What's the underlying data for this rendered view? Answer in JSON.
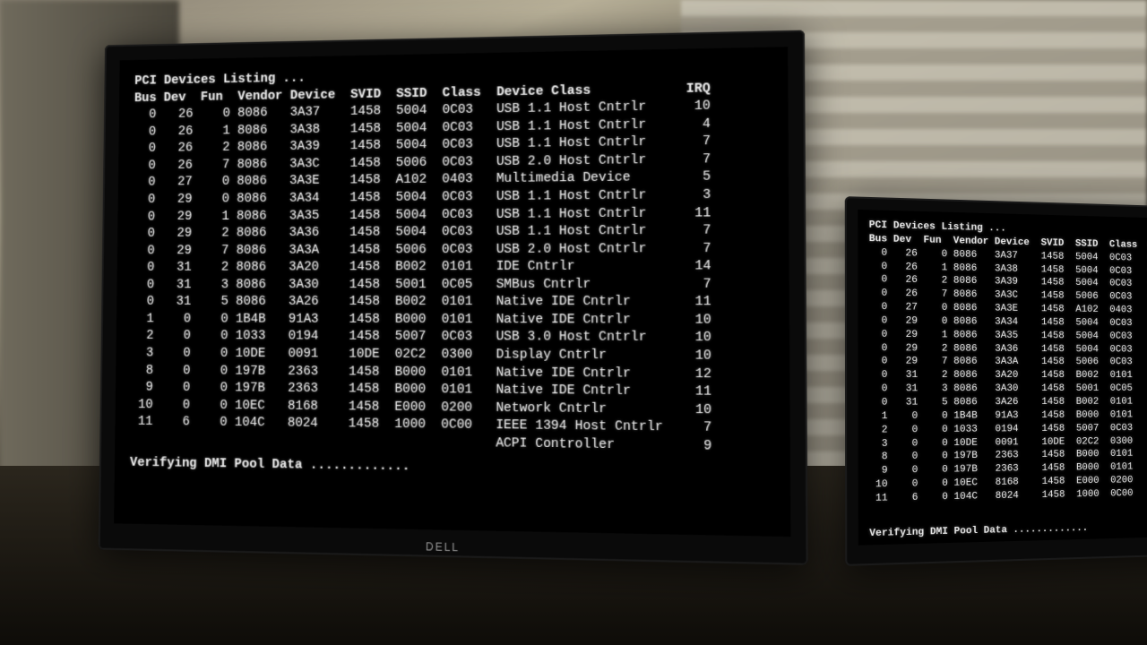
{
  "title": "PCI Devices Listing ...",
  "headers": {
    "bus": "Bus",
    "dev": "Dev",
    "fun": "Fun",
    "vendor": "Vendor",
    "device": "Device",
    "svid": "SVID",
    "ssid": "SSID",
    "class": "Class",
    "device_class": "Device Class",
    "irq": "IRQ"
  },
  "rows": [
    {
      "bus": "0",
      "dev": "26",
      "fun": "0",
      "vendor": "8086",
      "device": "3A37",
      "svid": "1458",
      "ssid": "5004",
      "class": "0C03",
      "device_class": "USB 1.1 Host Cntrlr",
      "irq": "10"
    },
    {
      "bus": "0",
      "dev": "26",
      "fun": "1",
      "vendor": "8086",
      "device": "3A38",
      "svid": "1458",
      "ssid": "5004",
      "class": "0C03",
      "device_class": "USB 1.1 Host Cntrlr",
      "irq": "4"
    },
    {
      "bus": "0",
      "dev": "26",
      "fun": "2",
      "vendor": "8086",
      "device": "3A39",
      "svid": "1458",
      "ssid": "5004",
      "class": "0C03",
      "device_class": "USB 1.1 Host Cntrlr",
      "irq": "7"
    },
    {
      "bus": "0",
      "dev": "26",
      "fun": "7",
      "vendor": "8086",
      "device": "3A3C",
      "svid": "1458",
      "ssid": "5006",
      "class": "0C03",
      "device_class": "USB 2.0 Host Cntrlr",
      "irq": "7"
    },
    {
      "bus": "0",
      "dev": "27",
      "fun": "0",
      "vendor": "8086",
      "device": "3A3E",
      "svid": "1458",
      "ssid": "A102",
      "class": "0403",
      "device_class": "Multimedia Device",
      "irq": "5"
    },
    {
      "bus": "0",
      "dev": "29",
      "fun": "0",
      "vendor": "8086",
      "device": "3A34",
      "svid": "1458",
      "ssid": "5004",
      "class": "0C03",
      "device_class": "USB 1.1 Host Cntrlr",
      "irq": "3"
    },
    {
      "bus": "0",
      "dev": "29",
      "fun": "1",
      "vendor": "8086",
      "device": "3A35",
      "svid": "1458",
      "ssid": "5004",
      "class": "0C03",
      "device_class": "USB 1.1 Host Cntrlr",
      "irq": "11"
    },
    {
      "bus": "0",
      "dev": "29",
      "fun": "2",
      "vendor": "8086",
      "device": "3A36",
      "svid": "1458",
      "ssid": "5004",
      "class": "0C03",
      "device_class": "USB 1.1 Host Cntrlr",
      "irq": "7"
    },
    {
      "bus": "0",
      "dev": "29",
      "fun": "7",
      "vendor": "8086",
      "device": "3A3A",
      "svid": "1458",
      "ssid": "5006",
      "class": "0C03",
      "device_class": "USB 2.0 Host Cntrlr",
      "irq": "7"
    },
    {
      "bus": "0",
      "dev": "31",
      "fun": "2",
      "vendor": "8086",
      "device": "3A20",
      "svid": "1458",
      "ssid": "B002",
      "class": "0101",
      "device_class": "IDE Cntrlr",
      "irq": "14"
    },
    {
      "bus": "0",
      "dev": "31",
      "fun": "3",
      "vendor": "8086",
      "device": "3A30",
      "svid": "1458",
      "ssid": "5001",
      "class": "0C05",
      "device_class": "SMBus Cntrlr",
      "irq": "7"
    },
    {
      "bus": "0",
      "dev": "31",
      "fun": "5",
      "vendor": "8086",
      "device": "3A26",
      "svid": "1458",
      "ssid": "B002",
      "class": "0101",
      "device_class": "Native IDE Cntrlr",
      "irq": "11"
    },
    {
      "bus": "1",
      "dev": "0",
      "fun": "0",
      "vendor": "1B4B",
      "device": "91A3",
      "svid": "1458",
      "ssid": "B000",
      "class": "0101",
      "device_class": "Native IDE Cntrlr",
      "irq": "10"
    },
    {
      "bus": "2",
      "dev": "0",
      "fun": "0",
      "vendor": "1033",
      "device": "0194",
      "svid": "1458",
      "ssid": "5007",
      "class": "0C03",
      "device_class": "USB 3.0 Host Cntrlr",
      "irq": "10"
    },
    {
      "bus": "3",
      "dev": "0",
      "fun": "0",
      "vendor": "10DE",
      "device": "0091",
      "svid": "10DE",
      "ssid": "02C2",
      "class": "0300",
      "device_class": "Display Cntrlr",
      "irq": "10"
    },
    {
      "bus": "8",
      "dev": "0",
      "fun": "0",
      "vendor": "197B",
      "device": "2363",
      "svid": "1458",
      "ssid": "B000",
      "class": "0101",
      "device_class": "Native IDE Cntrlr",
      "irq": "12"
    },
    {
      "bus": "9",
      "dev": "0",
      "fun": "0",
      "vendor": "197B",
      "device": "2363",
      "svid": "1458",
      "ssid": "B000",
      "class": "0101",
      "device_class": "Native IDE Cntrlr",
      "irq": "11"
    },
    {
      "bus": "10",
      "dev": "0",
      "fun": "0",
      "vendor": "10EC",
      "device": "8168",
      "svid": "1458",
      "ssid": "E000",
      "class": "0200",
      "device_class": "Network Cntrlr",
      "irq": "10"
    },
    {
      "bus": "11",
      "dev": "6",
      "fun": "0",
      "vendor": "104C",
      "device": "8024",
      "svid": "1458",
      "ssid": "1000",
      "class": "0C00",
      "device_class": "IEEE 1394 Host Cntrlr",
      "irq": "7"
    }
  ],
  "acpi_line": "ACPI Controller",
  "acpi_irq": "9",
  "footer": "Verifying DMI Pool Data .............",
  "monitor_logo": "DELL"
}
